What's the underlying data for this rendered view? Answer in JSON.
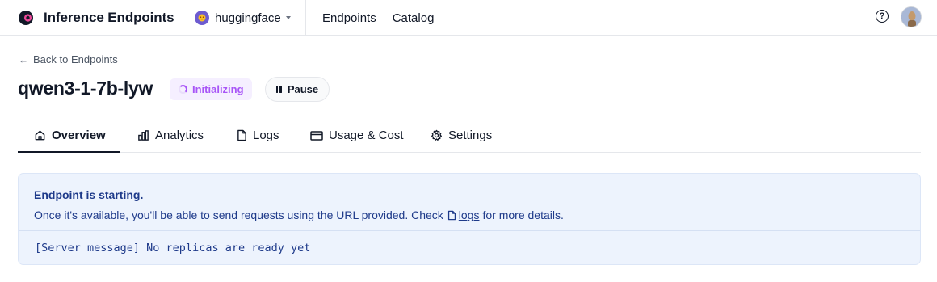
{
  "app": {
    "name": "Inference Endpoints"
  },
  "org": {
    "name": "huggingface"
  },
  "nav": {
    "items": [
      "Endpoints",
      "Catalog"
    ]
  },
  "header": {
    "help_icon": "help-circle-icon",
    "help_glyph": "?"
  },
  "back": {
    "label": "Back to Endpoints"
  },
  "endpoint": {
    "name": "qwen3-1-7b-lyw",
    "status": "Initializing",
    "status_color": "#a855f7"
  },
  "actions": {
    "pause_label": "Pause"
  },
  "tabs": [
    {
      "label": "Overview",
      "icon": "home-icon",
      "active": true
    },
    {
      "label": "Analytics",
      "icon": "bar-chart-icon",
      "active": false
    },
    {
      "label": "Logs",
      "icon": "file-icon",
      "active": false
    },
    {
      "label": "Usage & Cost",
      "icon": "credit-card-icon",
      "active": false
    },
    {
      "label": "Settings",
      "icon": "gear-icon",
      "active": false
    }
  ],
  "alert": {
    "title": "Endpoint is starting.",
    "body_prefix": "Once it's available, you'll be able to send requests using the URL provided. Check",
    "link_label": "logs",
    "body_suffix": "for more details.",
    "server_message": "[Server message] No replicas are ready yet",
    "text_color": "#1e3a8a",
    "background": "#edf3fd"
  },
  "colors": {
    "accent": "#a855f7",
    "text": "#111827",
    "border": "#e5e7eb"
  }
}
